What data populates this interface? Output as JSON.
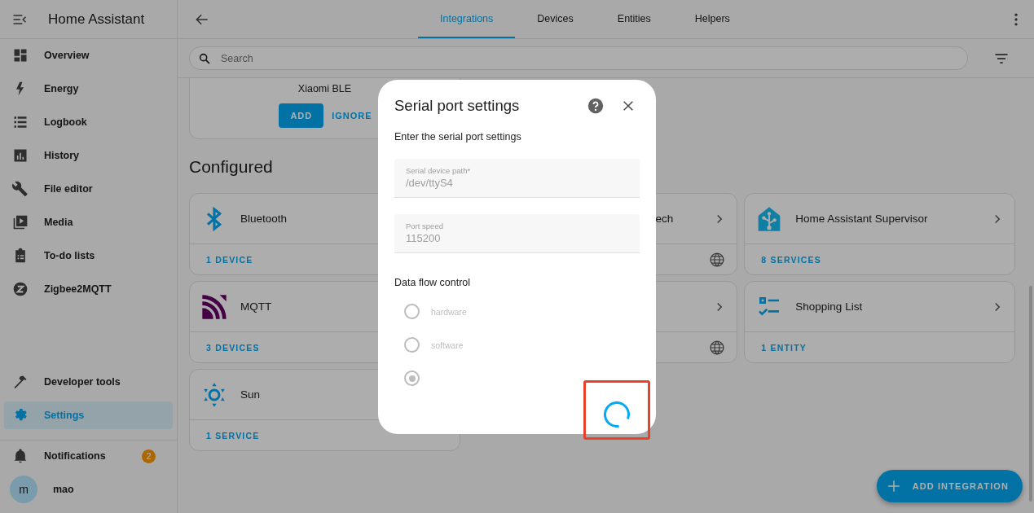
{
  "app": {
    "title": "Home Assistant"
  },
  "sidebar": {
    "items": [
      {
        "label": "Overview",
        "selected": false
      },
      {
        "label": "Energy",
        "selected": false
      },
      {
        "label": "Logbook",
        "selected": false
      },
      {
        "label": "History",
        "selected": false
      },
      {
        "label": "File editor",
        "selected": false
      },
      {
        "label": "Media",
        "selected": false
      },
      {
        "label": "To-do lists",
        "selected": false
      },
      {
        "label": "Zigbee2MQTT",
        "selected": false
      }
    ],
    "bottom_items": [
      {
        "label": "Developer tools",
        "selected": false
      },
      {
        "label": "Settings",
        "selected": true
      }
    ],
    "notifications": {
      "label": "Notifications",
      "badge": "2"
    },
    "user": {
      "initial": "m",
      "name": "mao"
    }
  },
  "tabs": [
    {
      "label": "Integrations",
      "selected": true
    },
    {
      "label": "Devices",
      "selected": false
    },
    {
      "label": "Entities",
      "selected": false
    },
    {
      "label": "Helpers",
      "selected": false
    }
  ],
  "search": {
    "placeholder": "Search"
  },
  "discovered": {
    "name": "Xiaomi BLE",
    "buttons": [
      "ADD",
      "IGNORE"
    ]
  },
  "section_title": "Configured",
  "cards": [
    {
      "kind": "plain",
      "name": "Bluetooth",
      "footer": "1 DEVICE"
    },
    {
      "kind": "covered",
      "name": "ech"
    },
    {
      "kind": "linked",
      "name": "Home Assistant Supervisor",
      "footer": "8 SERVICES"
    },
    {
      "kind": "plain",
      "name": "MQTT",
      "footer": "3 DEVICES"
    },
    {
      "kind": "covered"
    },
    {
      "kind": "linked",
      "name": "Shopping List",
      "footer": "1 ENTITY"
    },
    {
      "kind": "plain",
      "name": "Sun",
      "footer": "1 SERVICE"
    }
  ],
  "dialog": {
    "title": "Serial port settings",
    "description": "Enter the serial port settings",
    "fields": [
      {
        "label": "Serial device path*",
        "value": "/dev/ttyS4",
        "disabled": true
      },
      {
        "label": "Port speed",
        "value": "115200",
        "disabled": true
      }
    ],
    "radio_group": {
      "label": "Data flow control",
      "options": [
        {
          "label": "hardware",
          "selected": false,
          "disabled": true
        },
        {
          "label": "software",
          "selected": false,
          "disabled": true
        },
        {
          "selected": true,
          "disabled": true
        }
      ]
    },
    "loading": true
  },
  "fab": {
    "label": "ADD INTEGRATION"
  }
}
